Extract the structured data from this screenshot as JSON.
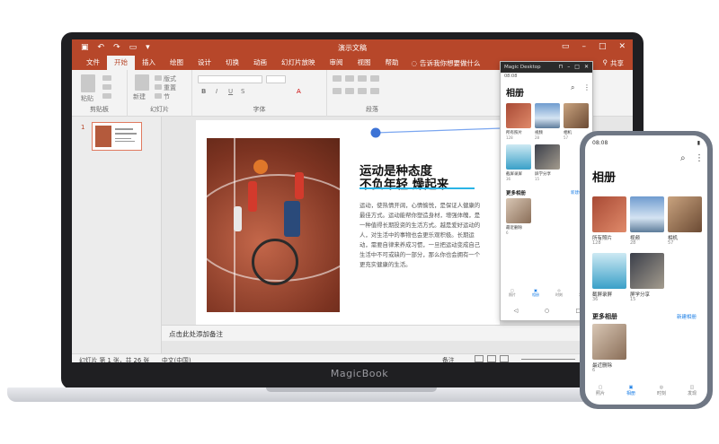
{
  "device": {
    "laptop_brand": "MagicBook"
  },
  "ppt": {
    "title": "演示文稿",
    "tabs": [
      "文件",
      "开始",
      "插入",
      "绘图",
      "设计",
      "切换",
      "动画",
      "幻灯片放映",
      "审阅",
      "视图",
      "帮助"
    ],
    "active_tab": "开始",
    "tell_me": "告诉我你想要做什么",
    "share": "共享",
    "ribbon_groups": [
      "剪贴板",
      "幻灯片",
      "字体",
      "段落"
    ],
    "ribbon_items": {
      "paste": "粘贴",
      "new_slide": "新建",
      "reuse": "重用",
      "layout": "版式",
      "reset": "重置",
      "section": "节"
    },
    "slide_number": "1",
    "slide": {
      "headline1": "运动是种态度",
      "headline2": "不负年轻 燥起来",
      "body": "运动，使热情开阔，心情愉悦，是保证人健康的最佳方式。运动能帮你塑造身材，增强体魄，是一种值得长期投资的生活方式。越是爱好运动的人，对生活中的事物也会更乐观积极。长期运动，需要自律来养成习惯，一旦把运动变成自己生活中不可或缺的一部分，那么你也会拥有一个更充实健康的生活。"
    },
    "notes_placeholder": "点击此处添加备注",
    "status": {
      "slide_of": "幻灯片 第 1 张，共 26 张",
      "language": "中文(中国)",
      "notes": "备注"
    }
  },
  "magic_window": {
    "title": "Magic Desktop",
    "status_time": "08:08"
  },
  "gallery": {
    "title": "相册",
    "albums": [
      {
        "name": "所有照片",
        "count": "128"
      },
      {
        "name": "视频",
        "count": "28"
      },
      {
        "name": "相机",
        "count": "57"
      },
      {
        "name": "截屏录屏",
        "count": "36"
      },
      {
        "name": "屏学分享",
        "count": "15"
      }
    ],
    "more_label": "更多相册",
    "new_album": "新建相册",
    "more_albums": [
      {
        "name": "最近删除",
        "count": "6"
      }
    ],
    "nav": [
      "照片",
      "相册",
      "时刻",
      "发现"
    ],
    "nav_active": "相册"
  },
  "phone": {
    "status_time": "08:08"
  },
  "colors": {
    "ppt_red": "#b7472a",
    "accent_blue": "#1a7ee6",
    "connector_blue": "#3d73d6"
  },
  "icons": [
    "save-icon",
    "undo-icon",
    "redo-icon",
    "search-icon",
    "more-icon",
    "lightbulb-icon",
    "share-icon",
    "back-icon",
    "photos-icon",
    "album-icon",
    "moments-icon",
    "discover-icon"
  ]
}
